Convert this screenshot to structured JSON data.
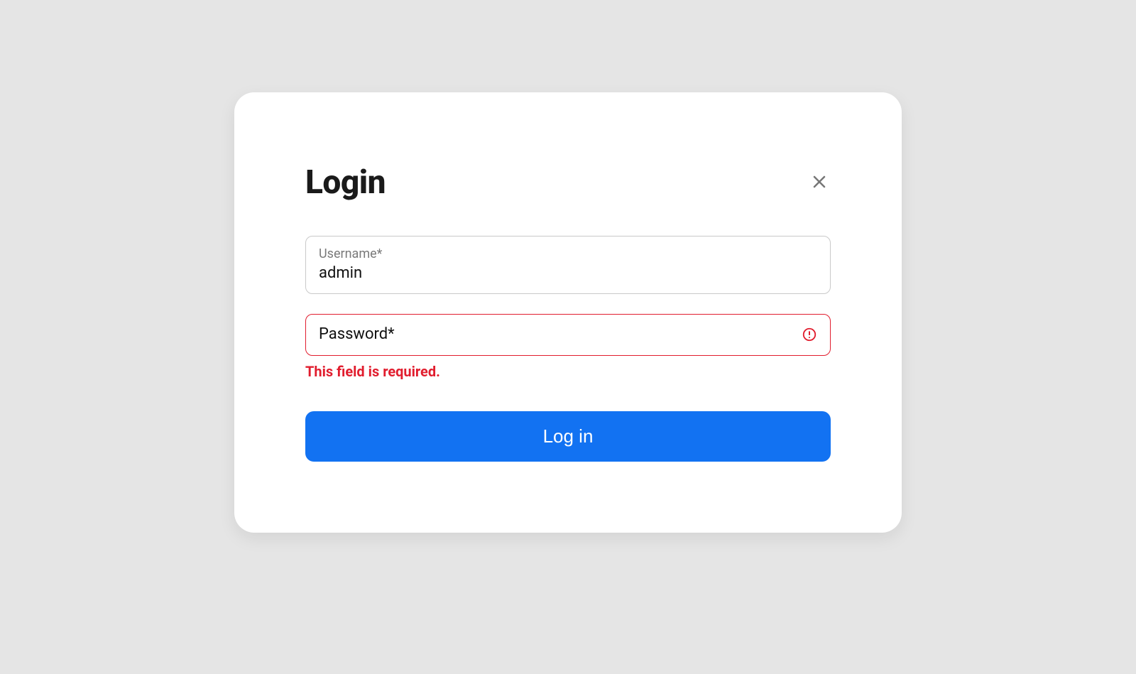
{
  "modal": {
    "title": "Login",
    "username": {
      "label": "Username*",
      "value": "admin"
    },
    "password": {
      "label": "Password*",
      "value": "",
      "error": "This field is required."
    },
    "submit_label": "Log in"
  },
  "colors": {
    "primary": "#1272f2",
    "error": "#e11d2e"
  }
}
